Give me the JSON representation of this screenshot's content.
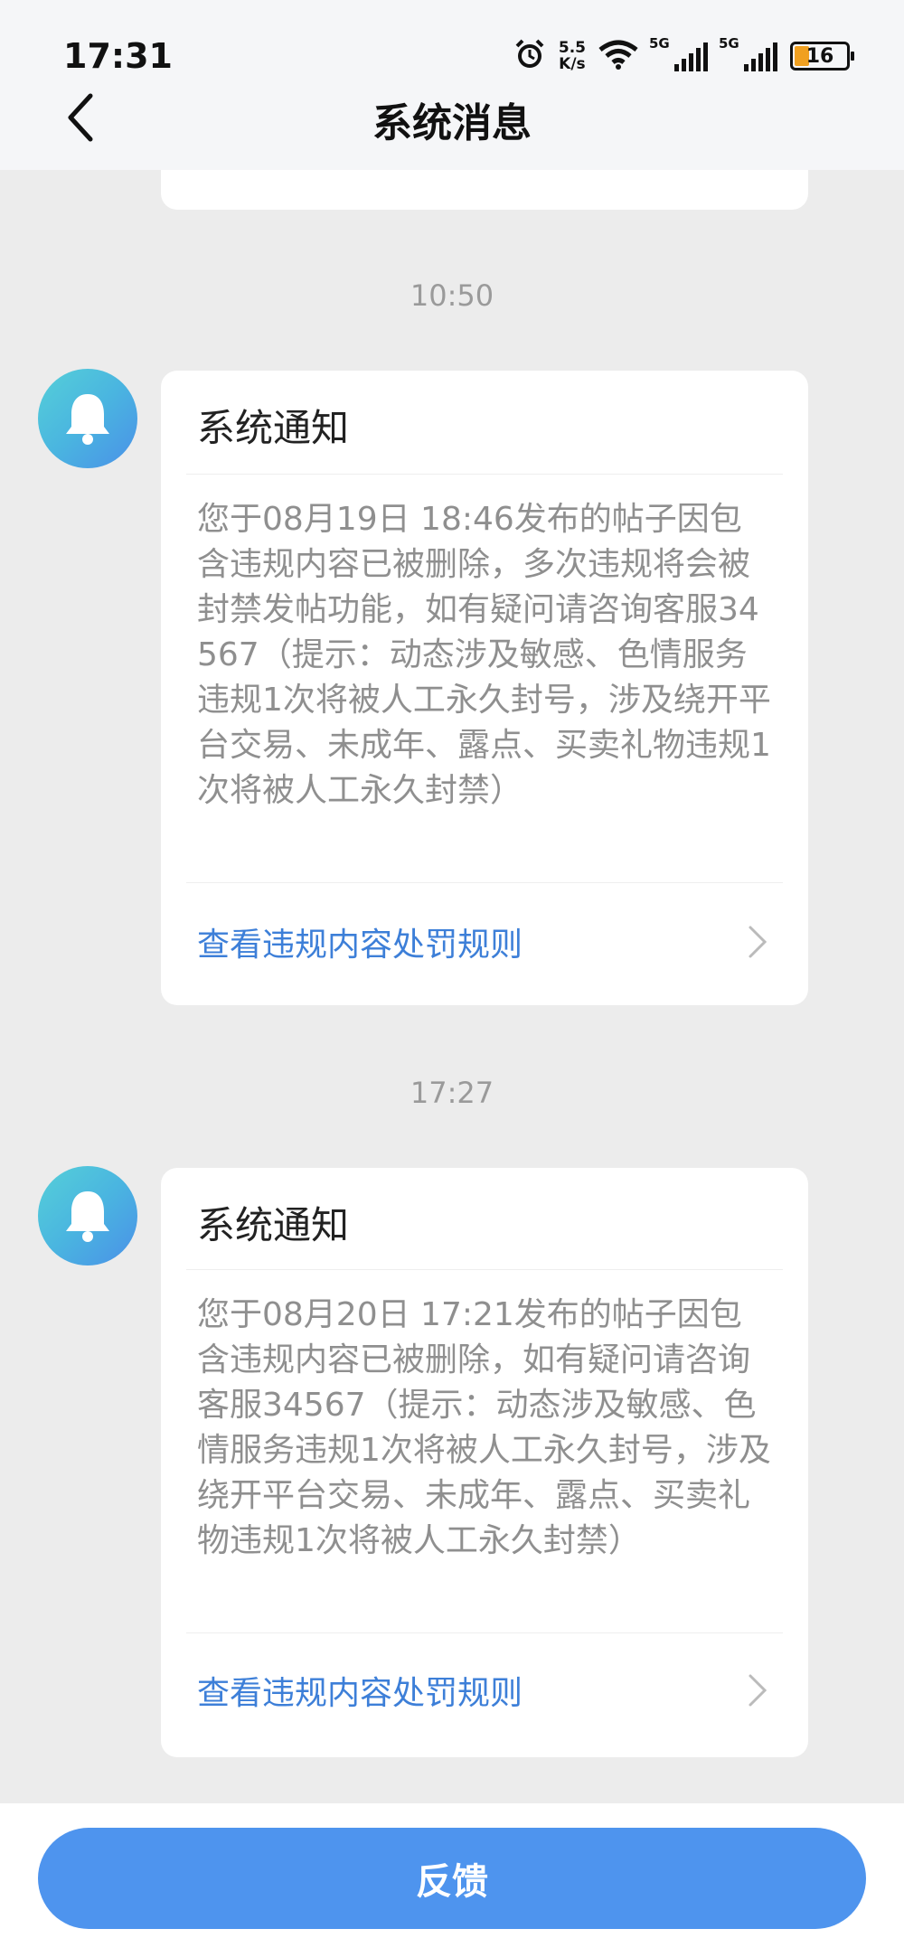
{
  "status_bar": {
    "time": "17:31",
    "net_speed_value": "5.5",
    "net_speed_unit": "K/s",
    "signal_1_label": "5G",
    "signal_2_label": "5G",
    "battery": "16",
    "icons": [
      "alarm-icon",
      "wifi-icon",
      "signal-icon",
      "battery-icon"
    ]
  },
  "nav": {
    "title": "系统消息",
    "back_icon": "chevron-left-icon"
  },
  "messages": [
    {
      "time": "10:50",
      "title": "系统通知",
      "body": "您于08月19日 18:46发布的帖子因包含违规内容已被删除，多次违规将会被封禁发帖功能，如有疑问请咨询客服34567（提示：动态涉及敏感、色情服务违规1次将被人工永久封号，涉及绕开平台交易、未成年、露点、买卖礼物违规1次将被人工永久封禁）",
      "link": "查看违规内容处罚规则"
    },
    {
      "time": "17:27",
      "title": "系统通知",
      "body": "您于08月20日 17:21发布的帖子因包含违规内容已被删除，如有疑问请咨询客服34567（提示：动态涉及敏感、色情服务违规1次将被人工永久封号，涉及绕开平台交易、未成年、露点、买卖礼物违规1次将被人工永久封禁）",
      "link": "查看违规内容处罚规则"
    }
  ],
  "footer": {
    "feedback_label": "反馈"
  },
  "colors": {
    "accent": "#4e94ee",
    "link": "#3d7fd8",
    "background": "#ececec"
  }
}
